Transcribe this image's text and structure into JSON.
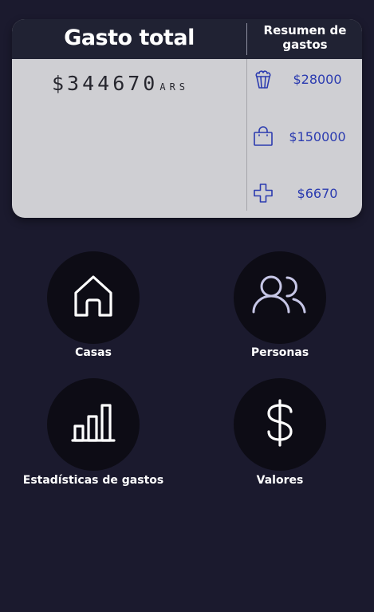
{
  "summary_card": {
    "title": "Gasto total",
    "summary_title": "Resumen de gastos",
    "total_amount": "$344670",
    "currency": "ARS",
    "rows": [
      {
        "icon": "popcorn-icon",
        "amount": "$28000"
      },
      {
        "icon": "shopping-bag-icon",
        "amount": "$150000"
      },
      {
        "icon": "health-cross-icon",
        "amount": "$6670"
      }
    ]
  },
  "menu": [
    {
      "icon": "home-icon",
      "label": "Casas"
    },
    {
      "icon": "users-icon",
      "label": "Personas"
    },
    {
      "icon": "bar-chart-icon",
      "label": "Estadísticas de gastos"
    },
    {
      "icon": "dollar-icon",
      "label": "Valores"
    }
  ],
  "colors": {
    "background": "#1b1a2e",
    "card": "#cfcfd3",
    "card_header": "#202233",
    "amount_text": "#2b3bb0",
    "tile": "#0d0c15"
  }
}
